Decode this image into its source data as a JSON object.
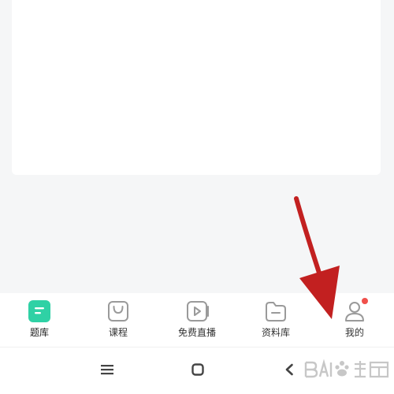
{
  "tabbar": {
    "items": [
      {
        "id": "question-bank",
        "label": "题库",
        "icon": "list-doc-icon",
        "active": true
      },
      {
        "id": "course",
        "label": "课程",
        "icon": "bag-icon",
        "active": false
      },
      {
        "id": "live",
        "label": "免费直播",
        "icon": "play-video-icon",
        "active": false
      },
      {
        "id": "materials",
        "label": "资料库",
        "icon": "folder-icon",
        "active": false
      },
      {
        "id": "mine",
        "label": "我的",
        "icon": "person-icon",
        "active": false,
        "badge_dot": true
      }
    ]
  },
  "system_nav": {
    "items": [
      "menu-icon",
      "home-square-icon",
      "back-chevron-icon"
    ]
  },
  "overlay": {
    "watermark_icon": "baidu-jingyan-watermark-icon"
  },
  "colors": {
    "accent": "#2fd1a5",
    "icon_gray": "#9a9a9a",
    "badge_red": "#f0504b",
    "arrow_red": "#c22020",
    "background": "#f5f6f7"
  }
}
